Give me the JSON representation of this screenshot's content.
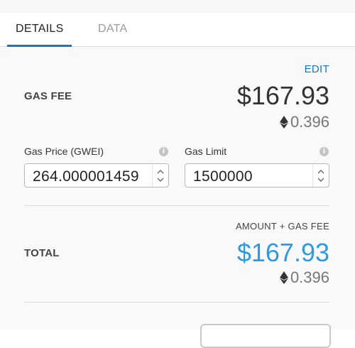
{
  "tabs": [
    {
      "label": "DETAILS"
    },
    {
      "label": "DATA"
    }
  ],
  "edit_label": "EDIT",
  "gas_fee": {
    "label": "GAS FEE",
    "usd": "$167.93",
    "eth": "0.396"
  },
  "gas_price": {
    "label": "Gas Price (GWEI)",
    "value": "264.000001459"
  },
  "gas_limit": {
    "label": "Gas Limit",
    "value": "1500000"
  },
  "total": {
    "caption": "AMOUNT + GAS FEE",
    "label": "TOTAL",
    "usd": "$167.93",
    "eth": "0.396"
  },
  "colors": {
    "accent": "#1b72c9",
    "total_blue": "#2f9ae0"
  },
  "icons": [
    "ethereum-icon",
    "info-icon",
    "stepper-up-icon",
    "stepper-down-icon"
  ]
}
